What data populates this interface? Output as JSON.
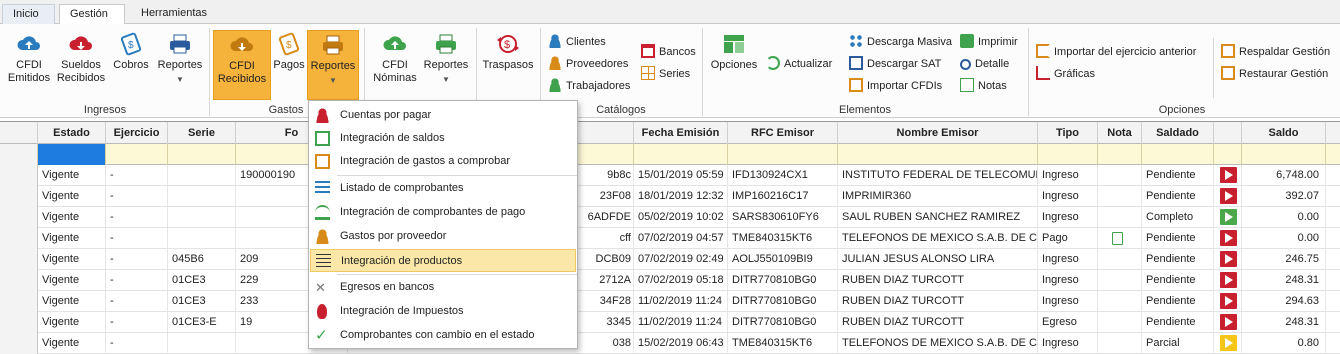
{
  "tabs": [
    "Inicio",
    "Gestión",
    "Herramientas"
  ],
  "ribbon": {
    "cfdi_emitidos": "CFDI Emitidos",
    "sueldos_recibidos": "Sueldos Recibidos",
    "cobros": "Cobros",
    "reportes1": "Reportes",
    "cfdi_recibidos": "CFDI Recibidos",
    "pagos": "Pagos",
    "reportes2": "Reportes",
    "cfdi_nominas": "CFDI Nóminas",
    "reportes3": "Reportes",
    "traspasos": "Traspasos",
    "clientes": "Clientes",
    "proveedores": "Proveedores",
    "trabajadores": "Trabajadores",
    "bancos": "Bancos",
    "series": "Series",
    "opciones": "Opciones",
    "actualizar": "Actualizar",
    "descarga_masiva": "Descarga Masiva",
    "descargar_sat": "Descargar SAT",
    "importar_cfdis": "Importar CFDIs",
    "imprimir": "Imprimir",
    "detalle": "Detalle",
    "notas": "Notas",
    "importar_ejercicio": "Importar del ejercicio anterior",
    "graficas": "Gráficas",
    "respaldar": "Respaldar Gestión",
    "restaurar": "Restaurar Gestión",
    "groups": {
      "ingresos": "Ingresos",
      "gastos": "Gastos",
      "catalogos": "Catálogos",
      "elementos": "Elementos",
      "opciones": "Opciones"
    }
  },
  "menu": [
    "Cuentas por pagar",
    "Integración de saldos",
    "Integración de gastos a comprobar",
    "Listado de comprobantes",
    "Integración de comprobantes de pago",
    "Gastos por proveedor",
    "Integración de productos",
    "Egresos en bancos",
    "Integración de Impuestos",
    "Comprobantes con cambio en el estado"
  ],
  "grid": {
    "headers": [
      "Estado",
      "Ejercicio",
      "Serie",
      "Fo",
      "Fecha Emisión",
      "RFC Emisor",
      "Nombre Emisor",
      "Tipo",
      "Nota",
      "Saldado",
      "Saldo"
    ],
    "rows": [
      [
        "Vigente",
        "-",
        "",
        "190000190",
        "9b8c",
        "15/01/2019 05:59",
        "IFD130924CX1",
        "INSTITUTO FEDERAL DE TELECOMUNIC",
        "Ingreso",
        "",
        "Pendiente",
        "red",
        "6,748.00"
      ],
      [
        "Vigente",
        "-",
        "",
        "",
        "23F08",
        "18/01/2019 12:32",
        "IMP160216C17",
        "IMPRIMIR360",
        "Ingreso",
        "",
        "Pendiente",
        "red",
        "392.07"
      ],
      [
        "Vigente",
        "-",
        "",
        "",
        "6ADFDE",
        "05/02/2019 10:02",
        "SARS830610FY6",
        "SAUL RUBEN SANCHEZ RAMIREZ",
        "Ingreso",
        "",
        "Completo",
        "green",
        "0.00"
      ],
      [
        "Vigente",
        "-",
        "",
        "",
        "cff",
        "07/02/2019 04:57",
        "TME840315KT6",
        "TELEFONOS DE MEXICO S.A.B. DE C.V.",
        "Pago",
        "note",
        "Pendiente",
        "red",
        "0.00"
      ],
      [
        "Vigente",
        "-",
        "045B6",
        "209",
        "DCB09",
        "07/02/2019 02:49",
        "AOLJ550109BI9",
        "JULIAN JESUS ALONSO LIRA",
        "Ingreso",
        "",
        "Pendiente",
        "red",
        "246.75"
      ],
      [
        "Vigente",
        "-",
        "01CE3",
        "229",
        "2712A",
        "07/02/2019 05:18",
        "DITR770810BG0",
        "RUBEN DIAZ TURCOTT",
        "Ingreso",
        "",
        "Pendiente",
        "red",
        "248.31"
      ],
      [
        "Vigente",
        "-",
        "01CE3",
        "233",
        "34F28",
        "11/02/2019 11:24",
        "DITR770810BG0",
        "RUBEN DIAZ TURCOTT",
        "Ingreso",
        "",
        "Pendiente",
        "red",
        "294.63"
      ],
      [
        "Vigente",
        "-",
        "01CE3-E",
        "19",
        "3345",
        "11/02/2019 11:24",
        "DITR770810BG0",
        "RUBEN DIAZ TURCOTT",
        "Egreso",
        "",
        "Pendiente",
        "red",
        "248.31"
      ],
      [
        "Vigente",
        "-",
        "",
        "",
        "038",
        "15/02/2019 06:43",
        "TME840315KT6",
        "TELEFONOS DE MEXICO S.A.B. DE C.V.",
        "Ingreso",
        "",
        "Parcial",
        "yellow",
        "0.80"
      ]
    ]
  },
  "colors": {
    "active": "#f6b33b",
    "red": "#c8202f",
    "green": "#4aa84a",
    "yellow": "#f5c518",
    "filter": "#fdf9d6",
    "highlight": "#fbe8a9"
  }
}
